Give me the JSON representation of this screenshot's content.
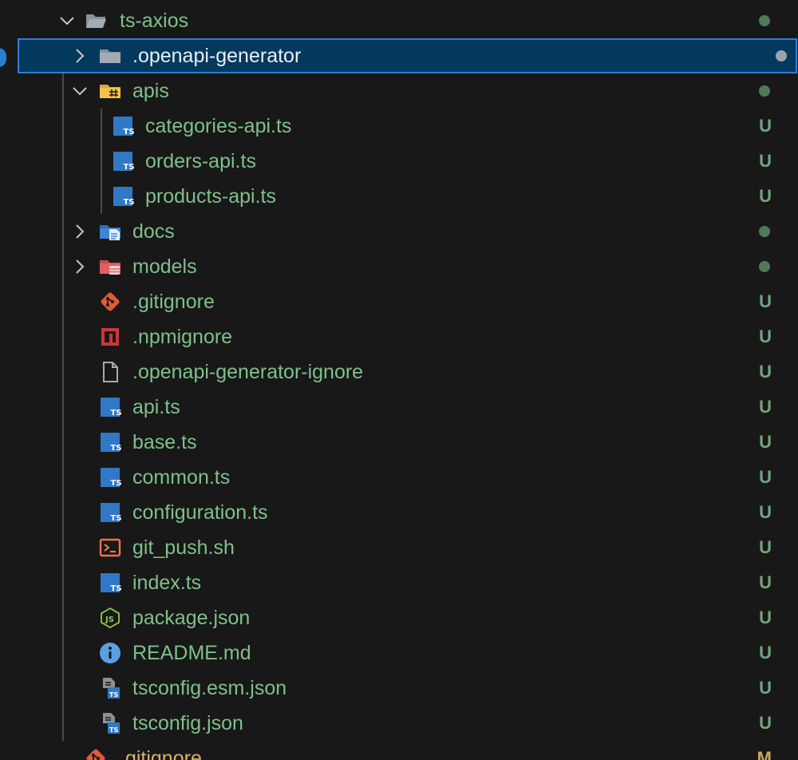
{
  "tree": {
    "items": [
      {
        "label": "ts-axios",
        "status": "",
        "kind": "folder-open",
        "indent": 0,
        "chevron": "down",
        "selected": false,
        "icon": "folder-open-icon"
      },
      {
        "label": ".openapi-generator",
        "status": "",
        "kind": "folder",
        "indent": 1,
        "chevron": "right",
        "selected": true,
        "icon": "folder-icon"
      },
      {
        "label": "apis",
        "status": "",
        "kind": "folder-api",
        "indent": 1,
        "chevron": "down",
        "selected": false,
        "icon": "api-folder-icon"
      },
      {
        "label": "categories-api.ts",
        "status": "U",
        "kind": "ts",
        "indent": 2,
        "chevron": "",
        "selected": false,
        "icon": "typescript-icon"
      },
      {
        "label": "orders-api.ts",
        "status": "U",
        "kind": "ts",
        "indent": 2,
        "chevron": "",
        "selected": false,
        "icon": "typescript-icon"
      },
      {
        "label": "products-api.ts",
        "status": "U",
        "kind": "ts",
        "indent": 2,
        "chevron": "",
        "selected": false,
        "icon": "typescript-icon"
      },
      {
        "label": "docs",
        "status": "",
        "kind": "folder-docs",
        "indent": 1,
        "chevron": "right",
        "selected": false,
        "icon": "docs-folder-icon"
      },
      {
        "label": "models",
        "status": "",
        "kind": "folder-models",
        "indent": 1,
        "chevron": "right",
        "selected": false,
        "icon": "models-folder-icon"
      },
      {
        "label": ".gitignore",
        "status": "U",
        "kind": "git",
        "indent": 1,
        "chevron": "",
        "selected": false,
        "icon": "git-icon"
      },
      {
        "label": ".npmignore",
        "status": "U",
        "kind": "npm",
        "indent": 1,
        "chevron": "",
        "selected": false,
        "icon": "npm-icon"
      },
      {
        "label": ".openapi-generator-ignore",
        "status": "U",
        "kind": "file",
        "indent": 1,
        "chevron": "",
        "selected": false,
        "icon": "file-icon"
      },
      {
        "label": "api.ts",
        "status": "U",
        "kind": "ts",
        "indent": 1,
        "chevron": "",
        "selected": false,
        "icon": "typescript-icon"
      },
      {
        "label": "base.ts",
        "status": "U",
        "kind": "ts",
        "indent": 1,
        "chevron": "",
        "selected": false,
        "icon": "typescript-icon"
      },
      {
        "label": "common.ts",
        "status": "U",
        "kind": "ts",
        "indent": 1,
        "chevron": "",
        "selected": false,
        "icon": "typescript-icon"
      },
      {
        "label": "configuration.ts",
        "status": "U",
        "kind": "ts",
        "indent": 1,
        "chevron": "",
        "selected": false,
        "icon": "typescript-icon"
      },
      {
        "label": "git_push.sh",
        "status": "U",
        "kind": "shell",
        "indent": 1,
        "chevron": "",
        "selected": false,
        "icon": "terminal-icon"
      },
      {
        "label": "index.ts",
        "status": "U",
        "kind": "ts",
        "indent": 1,
        "chevron": "",
        "selected": false,
        "icon": "typescript-icon"
      },
      {
        "label": "package.json",
        "status": "U",
        "kind": "node",
        "indent": 1,
        "chevron": "",
        "selected": false,
        "icon": "nodejs-icon"
      },
      {
        "label": "README.md",
        "status": "U",
        "kind": "info",
        "indent": 1,
        "chevron": "",
        "selected": false,
        "icon": "info-icon"
      },
      {
        "label": "tsconfig.esm.json",
        "status": "U",
        "kind": "tsconfig",
        "indent": 1,
        "chevron": "",
        "selected": false,
        "icon": "tsconfig-icon"
      },
      {
        "label": "tsconfig.json",
        "status": "U",
        "kind": "tsconfig",
        "indent": 1,
        "chevron": "",
        "selected": false,
        "icon": "tsconfig-icon"
      },
      {
        "label": ".gitignore",
        "status": "M",
        "kind": "git",
        "indent": 0,
        "chevron": "",
        "selected": false,
        "icon": "git-icon"
      }
    ],
    "colors": {
      "untracked": "#74a57a",
      "modified": "#c8a95c",
      "selection": "#04395e",
      "selection_border": "#2a7fd4"
    }
  }
}
